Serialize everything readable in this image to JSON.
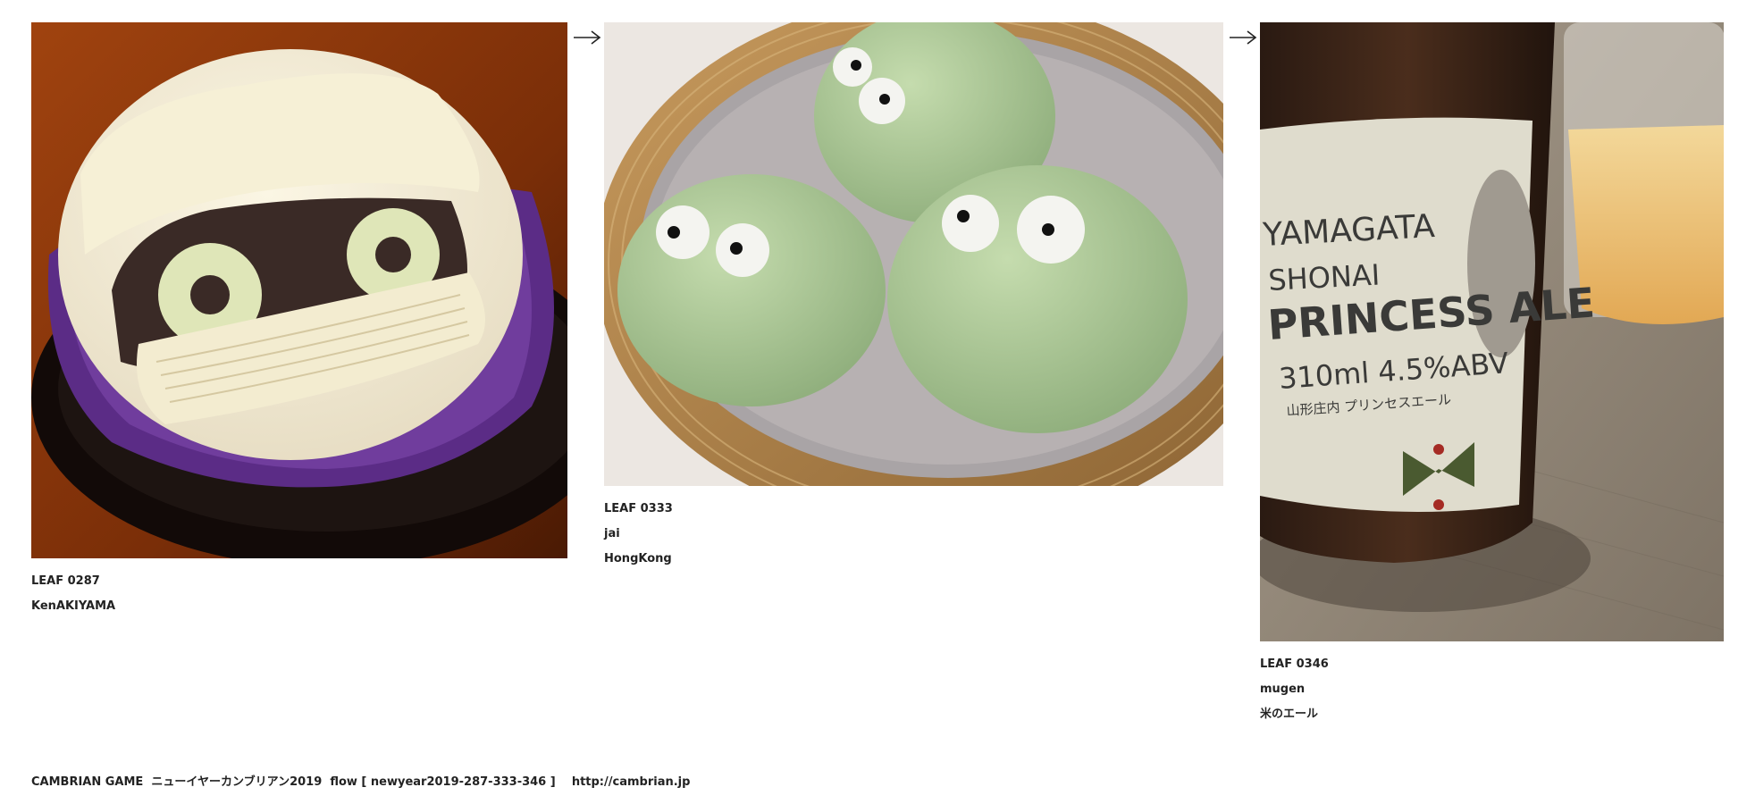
{
  "leaves": [
    {
      "id": "LEAF 0287",
      "author": "KenAKIYAMA",
      "photo_subject": "mummy-cake-photo"
    },
    {
      "id": "LEAF 0333",
      "author": "jai",
      "note": "HongKong",
      "photo_subject": "frog-buns-photo"
    },
    {
      "id": "LEAF 0346",
      "author": "mugen",
      "note": "米のエール",
      "photo_subject": "beer-bottle-photo",
      "bottle_label": {
        "line1": "YAMAGATA",
        "line2": "SHONAI",
        "line3": "PRINCESS ALE",
        "line4": "310ml  4.5%ABV",
        "line5": "山形庄内 プリンセスエール"
      }
    }
  ],
  "arrow_icon": "right-arrow-icon",
  "footer": {
    "brand": "CAMBRIAN GAME",
    "title": "ニューイヤーカンブリアン2019",
    "flow": "flow [ newyear2019-287-333-346 ]",
    "url": "http://cambrian.jp"
  },
  "colors": {
    "background": "#ffffff",
    "text": "#222222"
  }
}
